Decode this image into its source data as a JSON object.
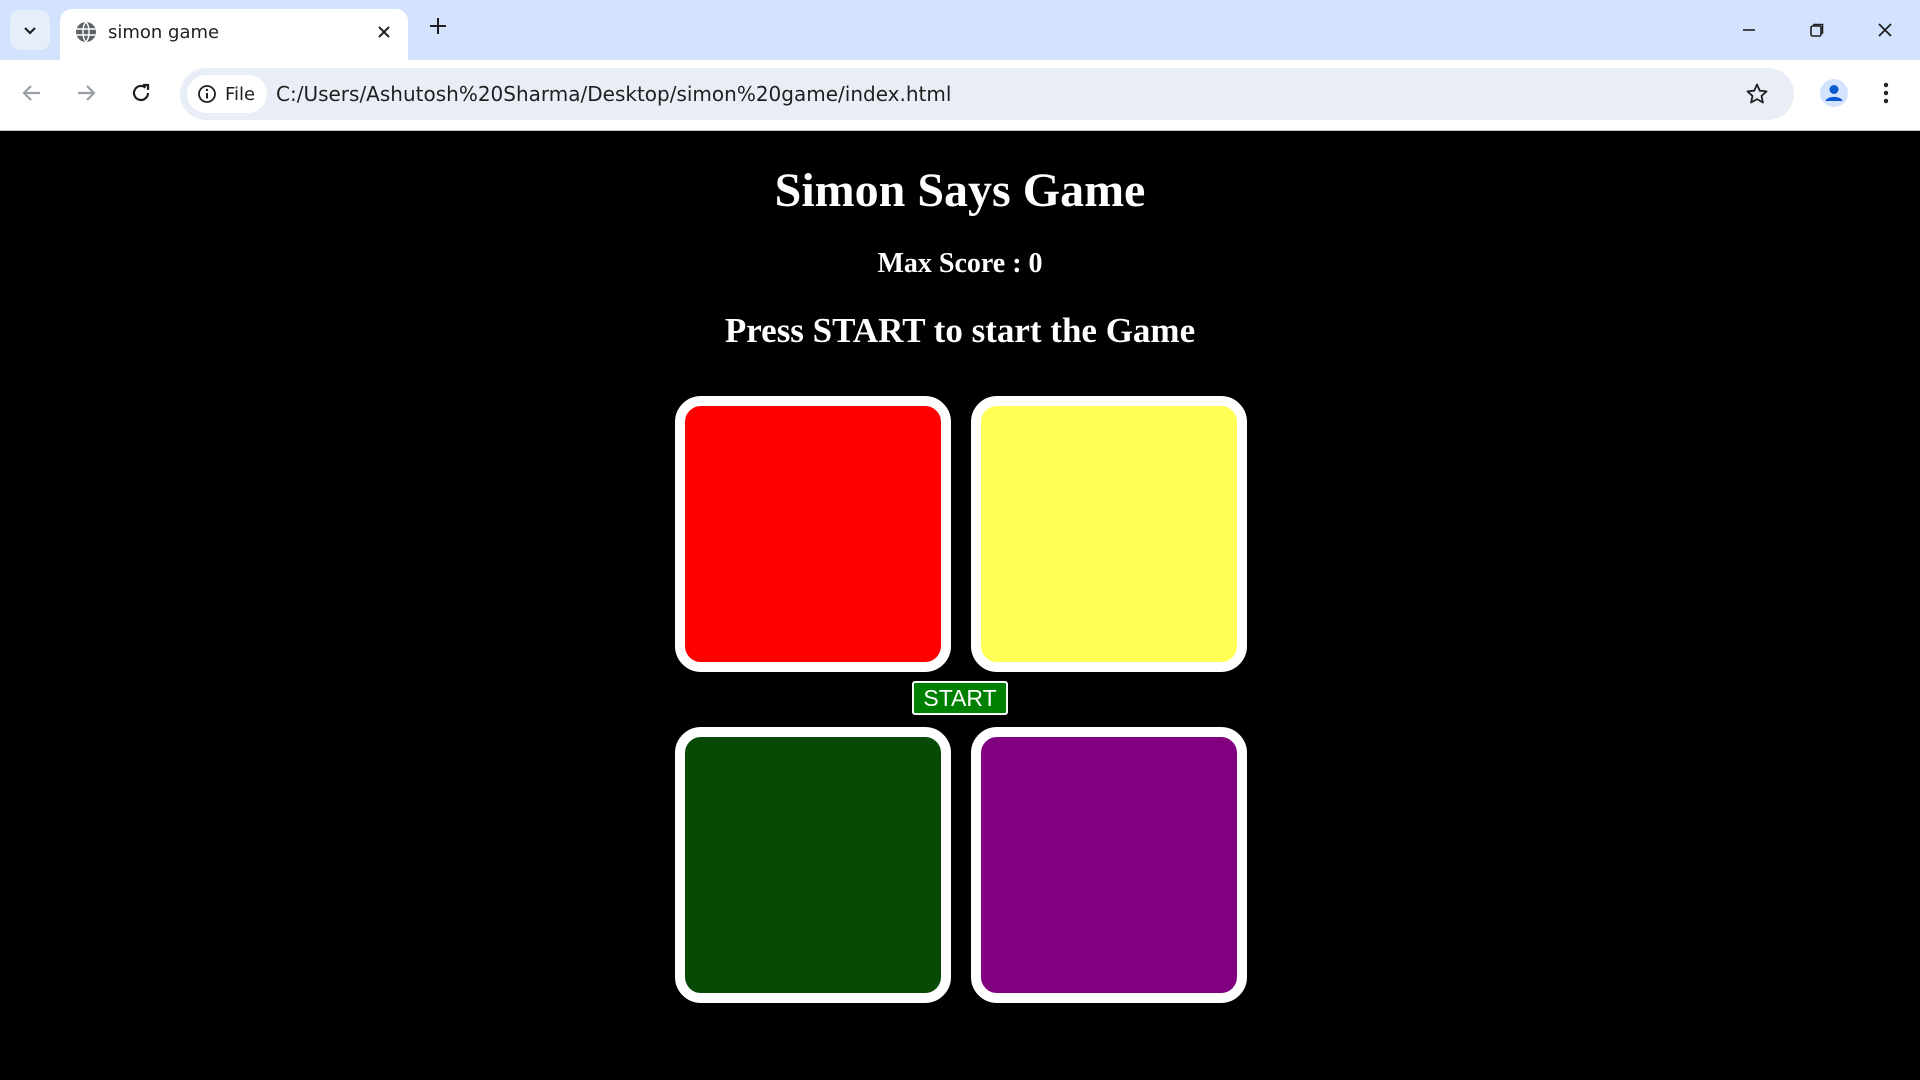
{
  "browser": {
    "tab_title": "simon game",
    "address_chip": "File",
    "url": "C:/Users/Ashutosh%20Sharma/Desktop/simon%20game/index.html"
  },
  "game": {
    "title": "Simon Says Game",
    "max_score": "Max Score : 0",
    "status": "Press START to start the Game",
    "start_label": "START",
    "pads": [
      {
        "name": "red",
        "color": "#ff0000"
      },
      {
        "name": "yellow",
        "color": "#ffff55"
      },
      {
        "name": "green",
        "color": "#064a06"
      },
      {
        "name": "purple",
        "color": "#800080"
      }
    ]
  },
  "colors": {
    "page_background": "#000000",
    "pad_border": "#ffffff",
    "start_button": "#008000",
    "browser_chrome": "#d3e3fd"
  }
}
